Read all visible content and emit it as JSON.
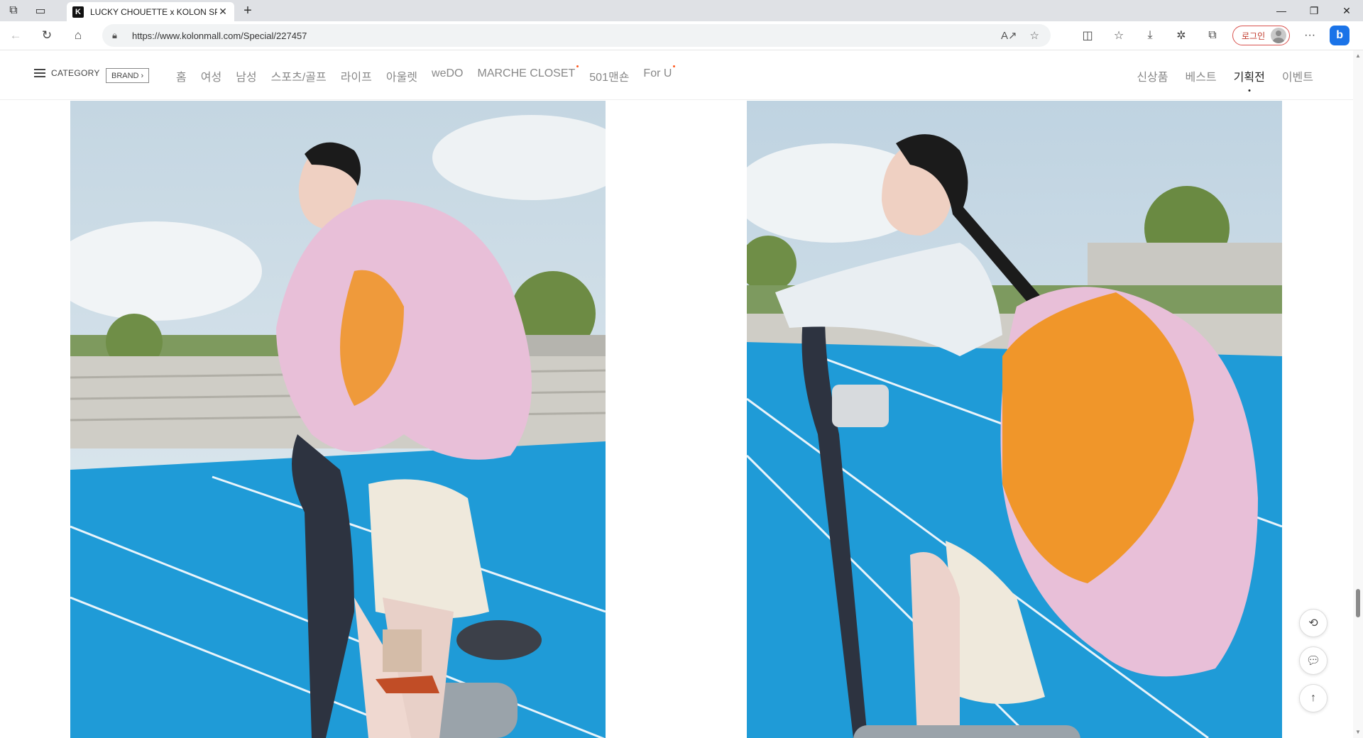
{
  "browser": {
    "tab_title": "LUCKY CHOUETTE x KOLON SPO",
    "favicon_letter": "K",
    "url": "https://www.kolonmall.com/Special/227457",
    "login_label": "로그인",
    "bing_letter": "b"
  },
  "site_nav": {
    "category_label": "CATEGORY",
    "brand_label": "BRAND ›",
    "items": [
      {
        "label": "홈",
        "dot": false
      },
      {
        "label": "여성",
        "dot": false
      },
      {
        "label": "남성",
        "dot": false
      },
      {
        "label": "스포츠/골프",
        "dot": false
      },
      {
        "label": "라이프",
        "dot": false
      },
      {
        "label": "아울렛",
        "dot": false
      },
      {
        "label": "weDO",
        "dot": false
      },
      {
        "label": "MARCHE CLOSET",
        "dot": true
      },
      {
        "label": "501맨숀",
        "dot": false
      },
      {
        "label": "For U",
        "dot": true
      }
    ],
    "right_items": [
      {
        "label": "신상품",
        "active": false
      },
      {
        "label": "베스트",
        "active": false
      },
      {
        "label": "기획전",
        "active": true
      },
      {
        "label": "이벤트",
        "active": false
      }
    ]
  },
  "colors": {
    "track_blue": "#1f9bd7",
    "sky": "#c9dbe6",
    "jacket_pink": "#e8bfd8",
    "vest_orange": "#f0962a",
    "login_red": "#d9534f"
  },
  "icons": {
    "tabstrip": [
      "workspaces-icon",
      "tab-actions-icon"
    ],
    "floats": [
      "history-icon",
      "chat-icon",
      "arrow-up-icon"
    ]
  }
}
